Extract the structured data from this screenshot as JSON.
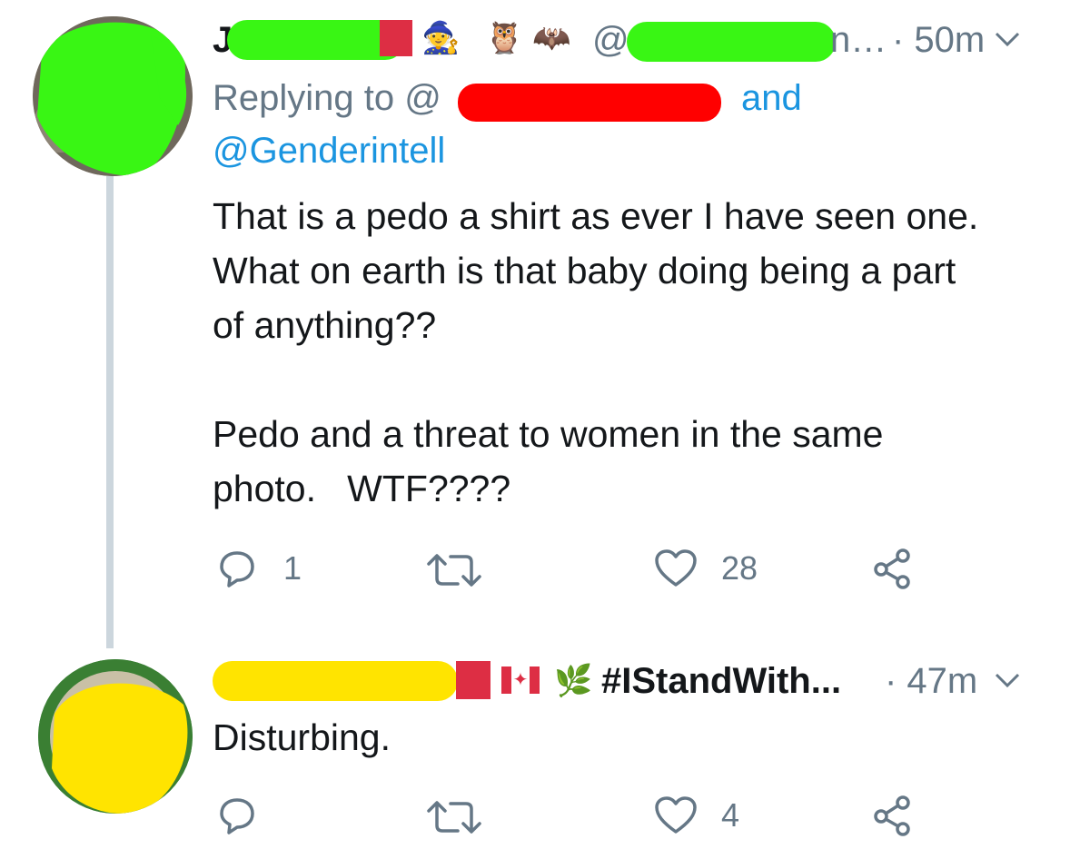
{
  "tweet1": {
    "name_visible": "J",
    "handle_visible": "@",
    "handle_tail": "n…",
    "time": "· 50m",
    "reply_prefix": "Replying to @",
    "reply_and": "and",
    "reply_second": "@Genderintell",
    "body_lines": [
      "That is a pedo a shirt as ever I have seen one.",
      "What on earth is that baby doing being a part",
      "of anything??",
      "",
      "Pedo and a threat to women in the same",
      "photo.   WTF????"
    ],
    "reply_count": "1",
    "retweet_count": "",
    "like_count": "28",
    "emojis": [
      "mage-woman-emoji",
      "owl-emoji",
      "bat-emoji"
    ],
    "redaction_colors": {
      "green": "#39f614",
      "red": "#ff0000"
    }
  },
  "tweet2": {
    "hashtag": "#IStandWith...",
    "time": "· 47m",
    "body": "Disturbing.",
    "reply_count": "",
    "retweet_count": "",
    "like_count": "4",
    "emojis": [
      "canada-flag-emoji",
      "herb-emoji"
    ],
    "redaction_colors": {
      "yellow": "#ffe400"
    }
  },
  "colors": {
    "text": "#14171a",
    "secondary": "#657786",
    "link": "#1b95e0",
    "thread_line": "#ccd6dd"
  }
}
